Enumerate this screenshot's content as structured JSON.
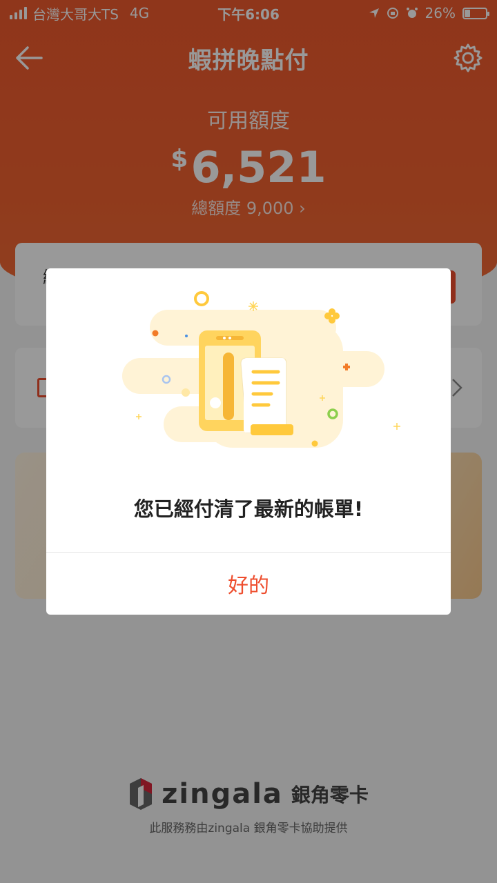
{
  "status_bar": {
    "carrier": "台灣大哥大TS",
    "network": "4G",
    "time": "下午6:06",
    "battery_percent": "26%",
    "battery_level": 0.26
  },
  "nav": {
    "title": "蝦拼晚點付",
    "back_icon": "arrow-left-icon",
    "settings_icon": "gear-icon"
  },
  "credit": {
    "label": "可用額度",
    "currency": "$",
    "amount": "6,521",
    "total_line": "總額度 9,000 ›"
  },
  "payment_card": {
    "label": "繳款截止日"
  },
  "dialog": {
    "message": "您已經付清了最新的帳單!",
    "ok_label": "好的",
    "illustration_icon": "phone-with-bill-icon"
  },
  "footer": {
    "brand": "zingala",
    "brand_cn": "銀角零卡",
    "note": "此服務務由zingala 銀角零卡協助提供"
  },
  "colors": {
    "accent": "#ee4d2d",
    "overlay": "rgba(0,0,0,0.4)",
    "illustration_yellow": "#ffc93c"
  }
}
